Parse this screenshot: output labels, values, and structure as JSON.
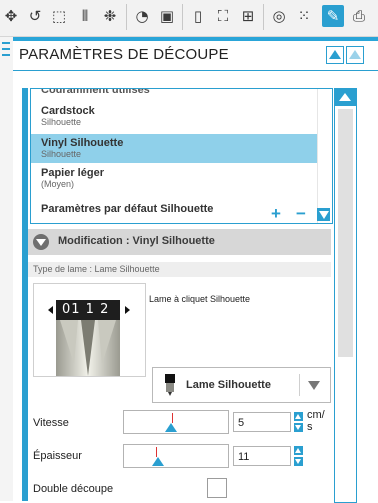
{
  "toolbar": {
    "icons": [
      "move-icon",
      "rotate-icon",
      "scale-icon",
      "align-icon",
      "replicate-icon",
      "library-icon",
      "fill-icon",
      "page-setup-icon",
      "registration-icon",
      "grid-icon",
      "trace-icon",
      "offset-icon",
      "cut-settings-icon",
      "send-icon"
    ],
    "active": "cut-settings-icon",
    "accent_color": "#2a9fd0"
  },
  "panel": {
    "title": "PARAMÈTRES DE DÉCOUPE"
  },
  "materials": {
    "partial_header": "Couramment utilisés",
    "items": [
      {
        "name": "Cardstock",
        "sub": "Silhouette",
        "selected": false
      },
      {
        "name": "Vinyl Silhouette",
        "sub": "Silhouette",
        "selected": true
      },
      {
        "name": "Papier léger",
        "sub": "(Moyen)",
        "selected": false
      },
      {
        "name": "Paramètres par défaut Silhouette",
        "sub": "",
        "selected": false
      }
    ],
    "add_label": "+",
    "remove_label": "−"
  },
  "modification": {
    "title": "Modification : Vinyl Silhouette",
    "blade_type": "Type de lame : Lame Silhouette",
    "blade_name": "Lame à cliquet Silhouette",
    "blade_dial": "01 1 2",
    "blade_select": "Lame Silhouette"
  },
  "speed": {
    "label": "Vitesse",
    "value": "5",
    "unit": "cm/\ns",
    "level": 0.45
  },
  "thickness": {
    "label": "Épaisseur",
    "value": "11",
    "level": 0.3
  },
  "double_cut": {
    "label": "Double découpe",
    "checked": false
  }
}
